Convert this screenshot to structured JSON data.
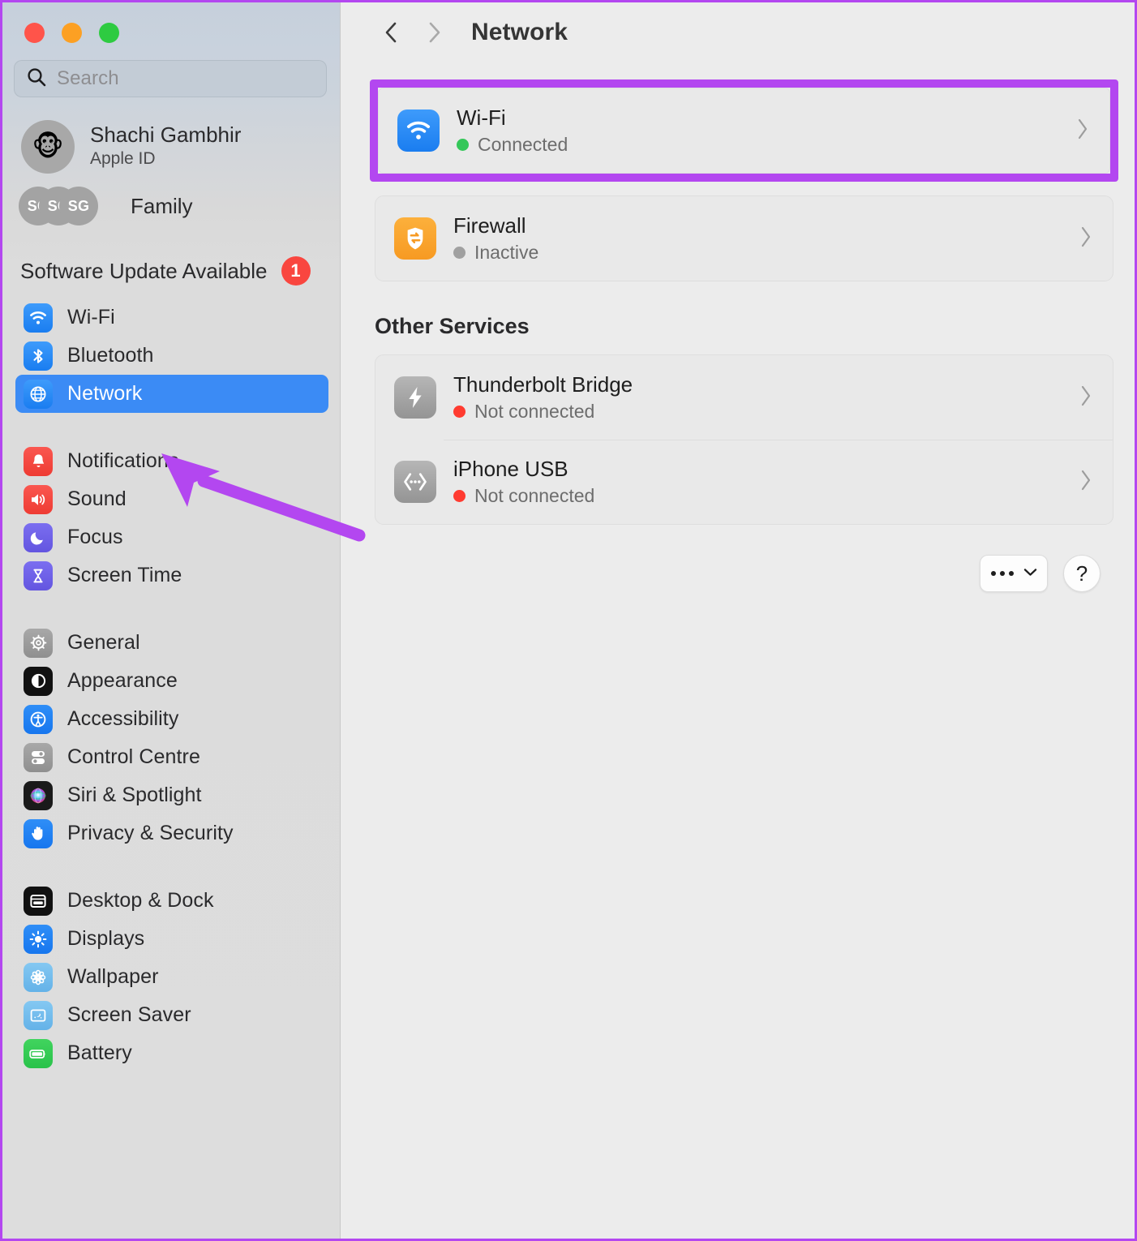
{
  "window": {
    "traffic_lights": [
      "close",
      "minimize",
      "zoom"
    ],
    "colors": {
      "close": "#ff544a",
      "minimize": "#fca023",
      "zoom": "#2ecb41",
      "accent_blue": "#3b8bf5",
      "annotation_purple": "#b347f0",
      "status_green": "#34c759",
      "status_red": "#ff3b30",
      "status_gray": "#a0a0a0",
      "badge_red": "#f9463f"
    }
  },
  "sidebar": {
    "search": {
      "placeholder": "Search",
      "value": "",
      "icon": "search-icon"
    },
    "account": {
      "name": "Shachi Gambhir",
      "subtitle": "Apple ID",
      "avatar_icon": "monkey-avatar"
    },
    "family": {
      "label": "Family",
      "avatar_initials": [
        "SG",
        "SG",
        "SG"
      ]
    },
    "update": {
      "label": "Software Update Available",
      "badge": "1"
    },
    "groups": [
      {
        "items": [
          {
            "label": "Wi-Fi",
            "icon": "wifi-icon",
            "selected": false
          },
          {
            "label": "Bluetooth",
            "icon": "bluetooth-icon",
            "selected": false
          },
          {
            "label": "Network",
            "icon": "globe-icon",
            "selected": true
          }
        ]
      },
      {
        "items": [
          {
            "label": "Notifications",
            "icon": "bell-icon",
            "selected": false
          },
          {
            "label": "Sound",
            "icon": "speaker-icon",
            "selected": false
          },
          {
            "label": "Focus",
            "icon": "moon-icon",
            "selected": false
          },
          {
            "label": "Screen Time",
            "icon": "hourglass-icon",
            "selected": false
          }
        ]
      },
      {
        "items": [
          {
            "label": "General",
            "icon": "gear-icon",
            "selected": false
          },
          {
            "label": "Appearance",
            "icon": "appearance-icon",
            "selected": false
          },
          {
            "label": "Accessibility",
            "icon": "accessibility-icon",
            "selected": false
          },
          {
            "label": "Control Centre",
            "icon": "control-centre-icon",
            "selected": false
          },
          {
            "label": "Siri & Spotlight",
            "icon": "siri-icon",
            "selected": false
          },
          {
            "label": "Privacy & Security",
            "icon": "hand-icon",
            "selected": false
          }
        ]
      },
      {
        "items": [
          {
            "label": "Desktop & Dock",
            "icon": "desktop-dock-icon",
            "selected": false
          },
          {
            "label": "Displays",
            "icon": "brightness-icon",
            "selected": false
          },
          {
            "label": "Wallpaper",
            "icon": "wallpaper-icon",
            "selected": false
          },
          {
            "label": "Screen Saver",
            "icon": "screen-saver-icon",
            "selected": false
          },
          {
            "label": "Battery",
            "icon": "battery-icon",
            "selected": false
          }
        ]
      }
    ]
  },
  "main": {
    "nav": {
      "back_icon": "chevron-left-icon",
      "forward_icon": "chevron-right-icon"
    },
    "title": "Network",
    "primary_services": [
      {
        "name": "Wi-Fi",
        "status": "Connected",
        "status_color": "#34c759",
        "icon": "wifi-icon",
        "highlighted": true
      },
      {
        "name": "Firewall",
        "status": "Inactive",
        "status_color": "#a0a0a0",
        "icon": "firewall-icon",
        "highlighted": false
      }
    ],
    "other_services_title": "Other Services",
    "other_services": [
      {
        "name": "Thunderbolt Bridge",
        "status": "Not connected",
        "status_color": "#ff3b30",
        "icon": "thunderbolt-icon"
      },
      {
        "name": "iPhone USB",
        "status": "Not connected",
        "status_color": "#ff3b30",
        "icon": "iphone-usb-icon"
      }
    ],
    "footer": {
      "more_label": "",
      "more_icon": "ellipsis-chevron-icon",
      "help_label": "?"
    }
  }
}
